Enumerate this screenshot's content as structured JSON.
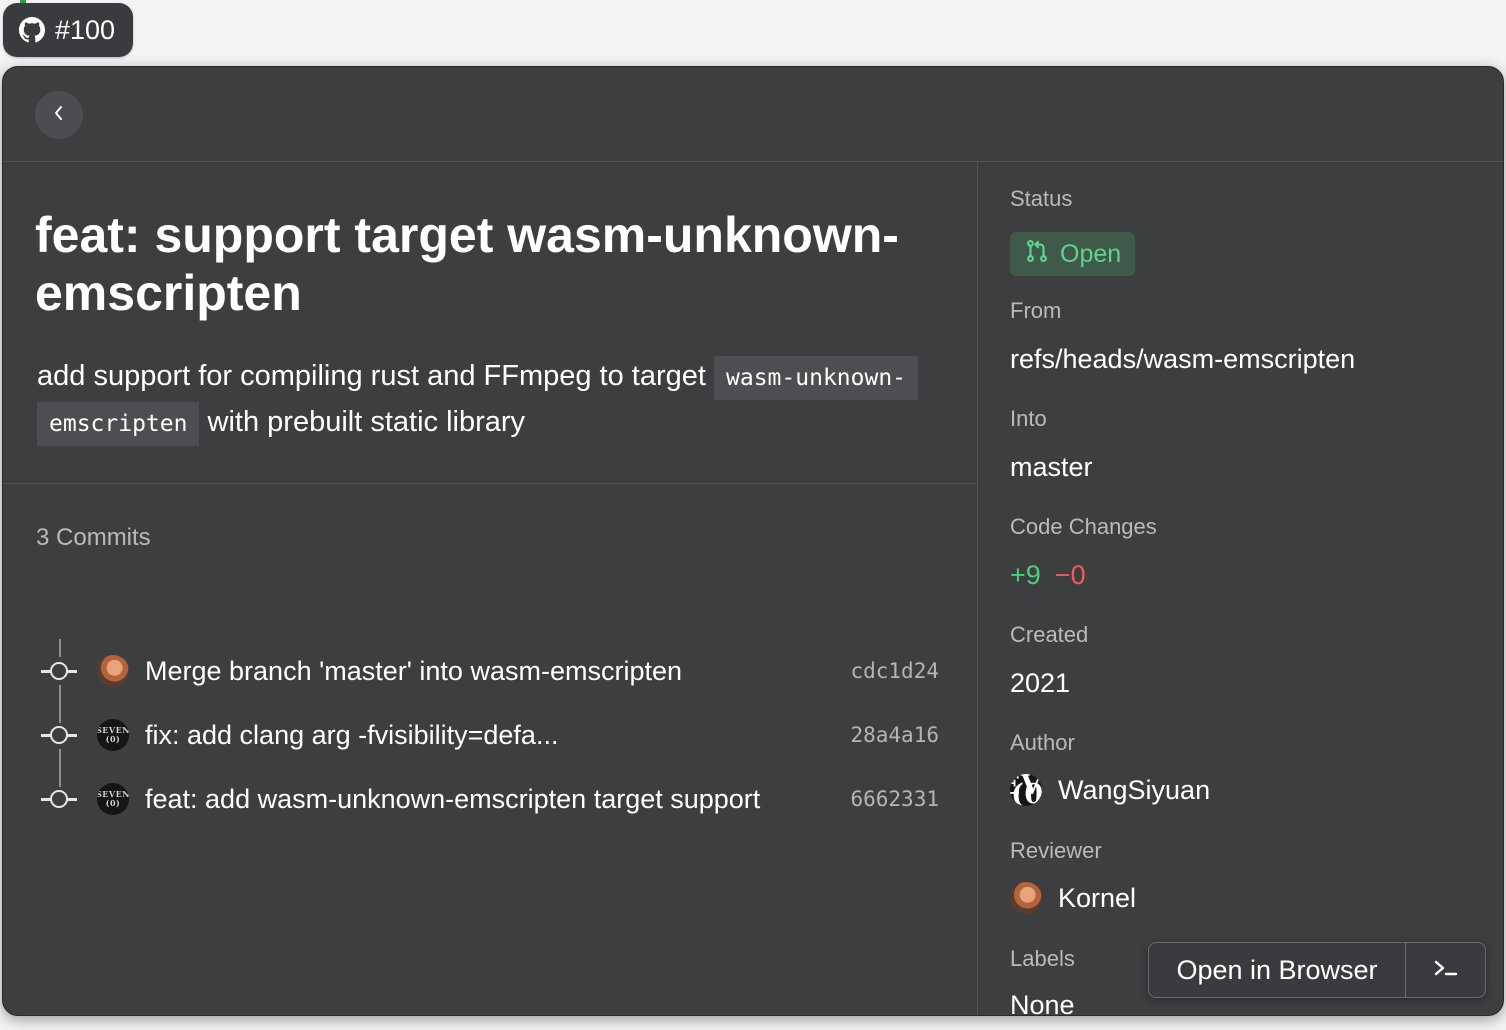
{
  "tag": {
    "label": "#100",
    "icon": "github-icon"
  },
  "header": {
    "back_icon": "chevron-left-icon"
  },
  "pull_request": {
    "title": "feat: support target wasm-unknown-emscripten",
    "description_before": "add support for compiling rust and FFmpeg to target ",
    "description_code_1": "wasm-unknown-",
    "description_code_2": "emscripten",
    "description_after": " with prebuilt static library"
  },
  "commits": {
    "heading": "3 Commits",
    "items": [
      {
        "message": "Merge branch 'master' into wasm-emscripten",
        "hash": "cdc1d24",
        "avatar": "Kornel"
      },
      {
        "message": "fix: add clang arg -fvisibility=defa...",
        "hash": "28a4a16",
        "avatar": "WangSiyuan"
      },
      {
        "message": "feat: add wasm-unknown-emscripten target support",
        "hash": "6662331",
        "avatar": "WangSiyuan"
      }
    ]
  },
  "sidebar": {
    "status_label": "Status",
    "status_value": "Open",
    "from_label": "From",
    "from_value": "refs/heads/wasm-emscripten",
    "into_label": "Into",
    "into_value": "master",
    "code_changes_label": "Code Changes",
    "additions": "+9",
    "deletions": "−0",
    "created_label": "Created",
    "created_value": "2021",
    "author_label": "Author",
    "author_name": "WangSiyuan",
    "reviewer_label": "Reviewer",
    "reviewer_name": "Kornel",
    "labels_label": "Labels",
    "labels_value": "None"
  },
  "avatar_text": {
    "line1": "SEVEN",
    "line2": "(0)"
  },
  "actions": {
    "open_browser": "Open in Browser",
    "terminal_icon": "terminal-icon"
  },
  "colors": {
    "open_green": "#5fd48c",
    "additions": "#4ccf7a",
    "deletions": "#ef5a5a"
  }
}
